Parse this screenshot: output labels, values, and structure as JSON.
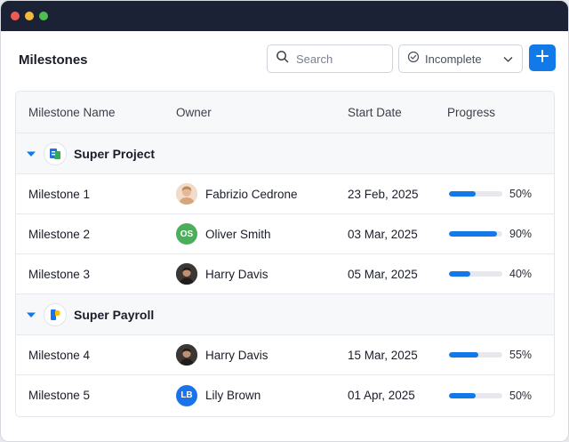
{
  "page": {
    "title": "Milestones"
  },
  "search": {
    "placeholder": "Search"
  },
  "filter": {
    "selected": "Incomplete"
  },
  "colors": {
    "accent": "#1279e8",
    "titlebar": "#1c2235"
  },
  "table": {
    "columns": [
      "Milestone Name",
      "Owner",
      "Start Date",
      "Progress"
    ],
    "groups": [
      {
        "name": "Super Project",
        "rows": [
          {
            "name": "Milestone 1",
            "owner": "Fabrizio Cedrone",
            "initials": "",
            "start": "23 Feb, 2025",
            "progress": 50,
            "progress_label": "50%"
          },
          {
            "name": "Milestone 2",
            "owner": "Oliver Smith",
            "initials": "OS",
            "start": "03 Mar, 2025",
            "progress": 90,
            "progress_label": "90%"
          },
          {
            "name": "Milestone 3",
            "owner": "Harry Davis",
            "initials": "",
            "start": "05 Mar, 2025",
            "progress": 40,
            "progress_label": "40%"
          }
        ]
      },
      {
        "name": "Super Payroll",
        "rows": [
          {
            "name": "Milestone 4",
            "owner": "Harry Davis",
            "initials": "",
            "start": "15 Mar, 2025",
            "progress": 55,
            "progress_label": "55%"
          },
          {
            "name": "Milestone 5",
            "owner": "Lily Brown",
            "initials": "LB",
            "start": "01 Apr, 2025",
            "progress": 50,
            "progress_label": "50%"
          }
        ]
      }
    ]
  }
}
